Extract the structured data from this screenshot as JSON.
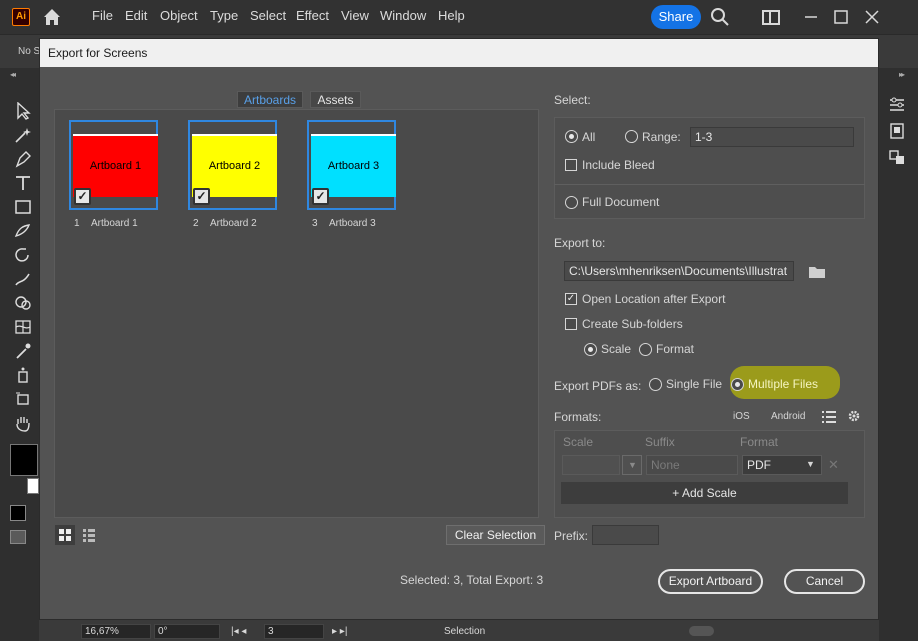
{
  "app": {
    "logo": "Ai",
    "menu": [
      "File",
      "Edit",
      "Object",
      "Type",
      "Select",
      "Effect",
      "View",
      "Window",
      "Help"
    ],
    "share_label": "Share",
    "control_bar_text": "No S",
    "status": {
      "zoom": "16,67%",
      "rotation": "0°",
      "artboard_num": "3",
      "tool": "Selection"
    }
  },
  "dialog": {
    "title": "Export for Screens",
    "tabs": [
      "Artboards",
      "Assets"
    ],
    "artboards": [
      {
        "num": "1",
        "name": "Artboard 1",
        "color": "#ff0000"
      },
      {
        "num": "2",
        "name": "Artboard 2",
        "color": "#ffff00"
      },
      {
        "num": "3",
        "name": "Artboard 3",
        "color": "#00e0ff"
      }
    ],
    "clear_selection": "Clear Selection",
    "summary": "Selected: 3, Total Export: 3",
    "select": {
      "label": "Select:",
      "all": "All",
      "range_label": "Range:",
      "range_value": "1-3",
      "include_bleed": "Include Bleed",
      "full_document": "Full Document"
    },
    "export_to": {
      "label": "Export to:",
      "path": "C:\\Users\\mhenriksen\\Documents\\Illustrat",
      "open_location": "Open Location after Export",
      "create_subfolders": "Create Sub-folders",
      "scale": "Scale",
      "format": "Format"
    },
    "export_pdfs": {
      "label": "Export PDFs as:",
      "single": "Single File",
      "multiple": "Multiple Files"
    },
    "formats": {
      "label": "Formats:",
      "ios": "iOS",
      "android": "Android",
      "col_scale": "Scale",
      "col_suffix": "Suffix",
      "col_format": "Format",
      "suffix_placeholder": "None",
      "format_value": "PDF",
      "add_scale": "Add Scale"
    },
    "prefix_label": "Prefix:",
    "export_button": "Export Artboard",
    "cancel_button": "Cancel"
  }
}
